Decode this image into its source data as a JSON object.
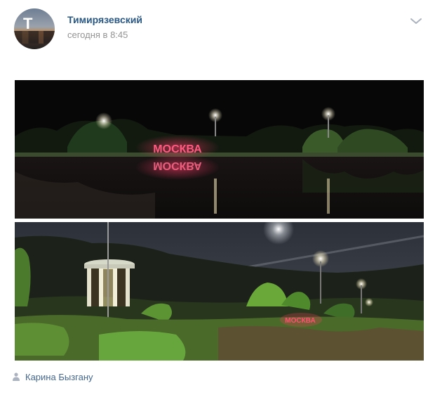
{
  "post": {
    "author": "Тимирязевский",
    "time": "сегодня в 8:45",
    "avatar_icon": "avatar-city-icon",
    "menu_icon": "chevron-down-icon"
  },
  "photos": [
    {
      "description_icon": "photo-night-moscow-sign",
      "sign_text": "МОСКВА"
    },
    {
      "description_icon": "photo-park-rotunda",
      "sign_text": "МОСКВА"
    }
  ],
  "signer": {
    "icon": "person-icon",
    "name": "Карина Бызгану"
  },
  "colors": {
    "link": "#2a5885",
    "meta": "#939393",
    "signer": "#45678f",
    "sign_red": "#ff4a6e"
  }
}
